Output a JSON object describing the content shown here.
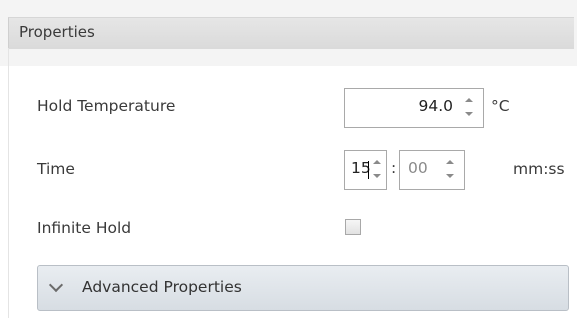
{
  "panel": {
    "title": "Properties"
  },
  "fields": {
    "hold_temperature": {
      "label": "Hold Temperature",
      "value": "94.0",
      "unit": "°C"
    },
    "time": {
      "label": "Time",
      "minutes": "15",
      "separator": ":",
      "seconds": "00",
      "unit": "mm:ss"
    },
    "infinite_hold": {
      "label": "Infinite Hold",
      "checked": false
    }
  },
  "advanced": {
    "label": "Advanced Properties",
    "expanded": false
  },
  "icons": {
    "spin_up": "spin-up-arrow-icon",
    "spin_down": "spin-down-arrow-icon",
    "expand": "chevron-down-icon"
  }
}
